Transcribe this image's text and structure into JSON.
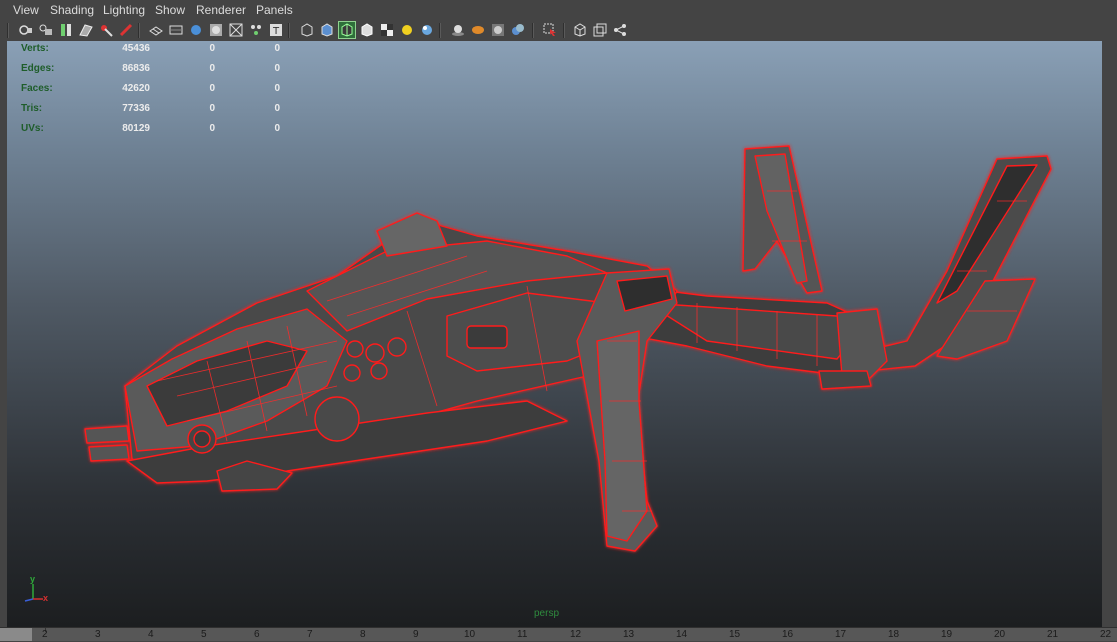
{
  "menu": [
    "View",
    "Shading",
    "Lighting",
    "Show",
    "Renderer",
    "Panels"
  ],
  "toolbar_icons": [
    "select-camera-icon",
    "lock-camera-icon",
    "bookmark-icon",
    "image-plane-icon",
    "2d-pan-icon",
    "grease-pencil-icon",
    "grid-icon",
    "film-gate-icon",
    "resolution-gate-icon",
    "gate-mask-icon",
    "field-chart-icon",
    "safe-action-icon",
    "safe-title-icon",
    "wireframe-icon",
    "smooth-shade-icon",
    "wireframe-on-shaded-icon",
    "flat-shade-icon",
    "textured-icon",
    "use-all-lights-icon",
    "shadows-icon",
    "ambient-occlusion-icon",
    "motion-blur-icon",
    "anti-aliasing-icon",
    "depth-of-field-icon",
    "isolate-select-icon",
    "xray-icon",
    "xray-joints-icon",
    "xray-components-icon"
  ],
  "hud": {
    "rows": [
      {
        "label": "Verts:",
        "v1": "45436",
        "v2": "0",
        "v3": "0"
      },
      {
        "label": "Edges:",
        "v1": "86836",
        "v2": "0",
        "v3": "0"
      },
      {
        "label": "Faces:",
        "v1": "42620",
        "v2": "0",
        "v3": "0"
      },
      {
        "label": "Tris:",
        "v1": "77336",
        "v2": "0",
        "v3": "0"
      },
      {
        "label": "UVs:",
        "v1": "80129",
        "v2": "0",
        "v3": "0"
      }
    ]
  },
  "camera_label": "persp",
  "axis": {
    "y": "y",
    "x": "x"
  },
  "timeline": [
    "2",
    "3",
    "4",
    "5",
    "6",
    "7",
    "8",
    "9",
    "10",
    "11",
    "12",
    "13",
    "14",
    "15",
    "16",
    "17",
    "18",
    "19",
    "20",
    "21",
    "22"
  ],
  "colors": {
    "wire": "#ff1a1a",
    "hull": "#4a4a4a",
    "hud_label": "#1e5d2a",
    "selected_tool": "#2e6f3a"
  }
}
